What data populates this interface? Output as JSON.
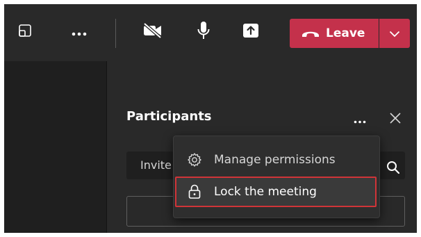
{
  "toolbar": {
    "icons": {
      "share_tray": "share-tray-icon",
      "more": "more-options-icon",
      "camera": "camera-off-icon",
      "mic": "microphone-icon",
      "share": "share-content-icon",
      "phone": "phone-hangup-icon",
      "chevron": "chevron-down-icon"
    },
    "leave_label": "Leave"
  },
  "panel": {
    "title": "Participants",
    "invite_text": "Invite"
  },
  "menu": {
    "items": [
      {
        "label": "Manage permissions",
        "icon": "gear-icon"
      },
      {
        "label": "Lock the meeting",
        "icon": "lock-icon"
      }
    ]
  },
  "colors": {
    "leave_red": "#c4314b",
    "highlight_red": "#d13438",
    "background": "#1f1f1f",
    "panel": "#292929"
  }
}
